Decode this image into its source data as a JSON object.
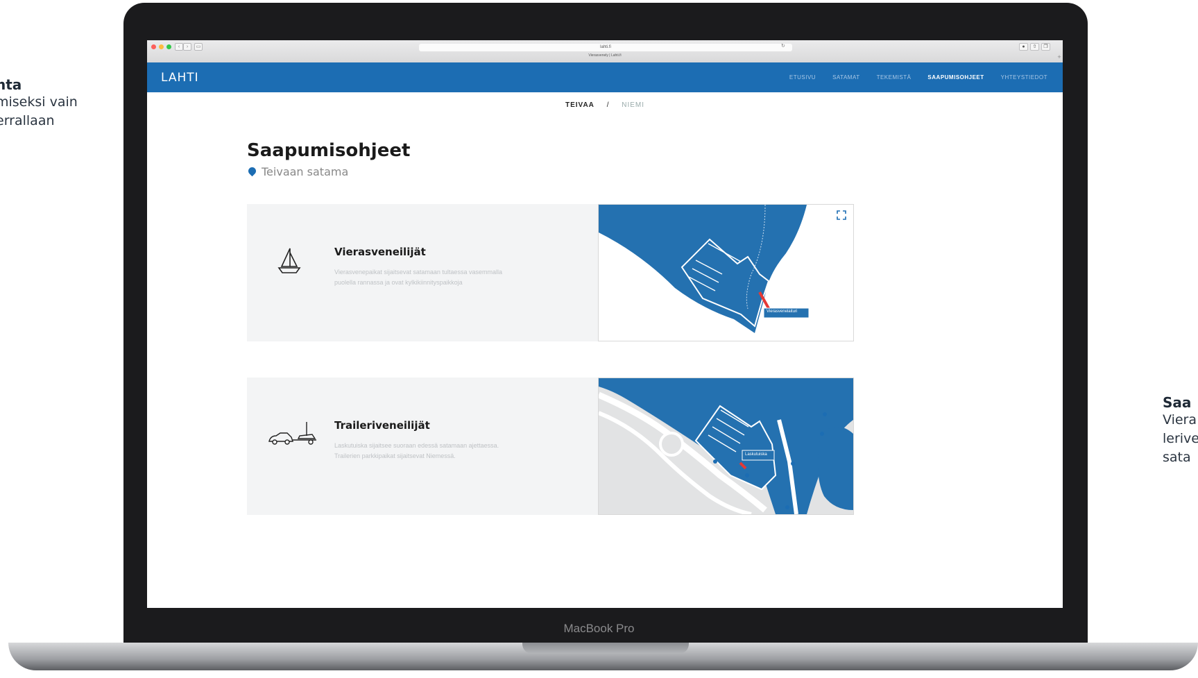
{
  "side_left": {
    "title": "nta",
    "line1": "miseksi vain",
    "line2": "errallaan"
  },
  "side_right": {
    "title": "Saa",
    "line1": "Viera",
    "line2": "lerive",
    "line3": "sata"
  },
  "device_label": "MacBook Pro",
  "browser": {
    "url": "lahti.fi",
    "tab_title": "Vierasvenely | Lahti.fi"
  },
  "header": {
    "logo": "LAHTI",
    "menu": [
      "ETUSIVU",
      "SATAMAT",
      "TEKEMISTÄ",
      "SAAPUMISOHJEET",
      "YHTEYSTIEDOT"
    ],
    "active_index": 3
  },
  "harbor_tabs": {
    "active": "TEIVAA",
    "separator": "/",
    "inactive": "NIEMI"
  },
  "page": {
    "title": "Saapumisohjeet",
    "location": "Teivaan satama"
  },
  "cards": [
    {
      "heading": "Vierasveneilijät",
      "text": "Vierasvenepaikat sijaitsevat satamaan tultaessa vasemmalla puolella rannassa ja ovat kylkikiinnityspaikkoja",
      "map_label": "Vierasvenelaituri",
      "icon": "sailboat-icon"
    },
    {
      "heading": "Traileriveneilijät",
      "text": "Laskutuiska sijaitsee suoraan edessä satamaan ajettaessa. Trailerien parkkipaikat sijaitsevat Niemessä.",
      "map_label": "Laskutuiska",
      "icon": "car-trailer-icon"
    }
  ],
  "colors": {
    "brand_blue": "#1c6db3",
    "water": "#2471b0",
    "marker_red": "#e53935"
  }
}
